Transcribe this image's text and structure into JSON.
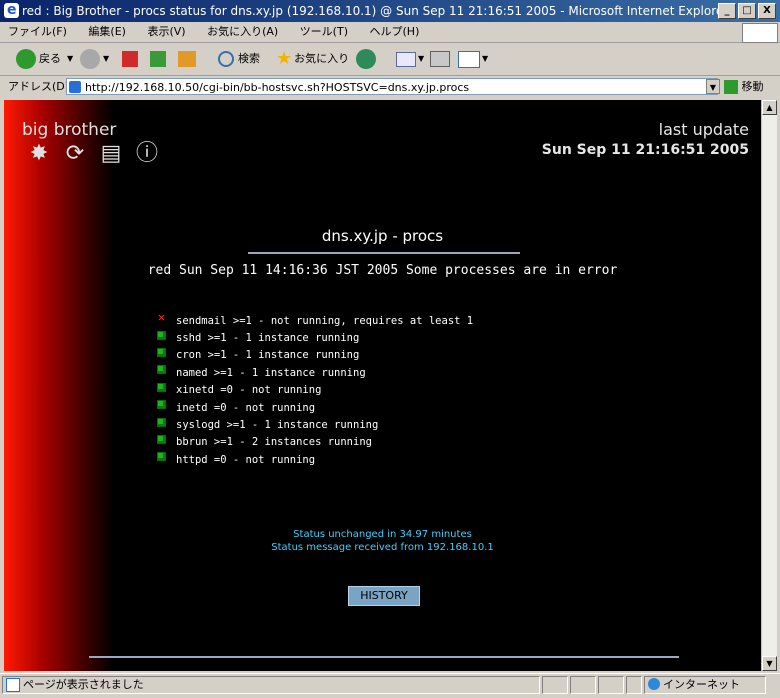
{
  "window": {
    "title": "red : Big Brother - procs status for dns.xy.jp (192.168.10.1) @ Sun Sep 11 21:16:51 2005 - Microsoft Internet Explorer",
    "min": "_",
    "max": "□",
    "close": "X"
  },
  "menu": [
    "ファイル(F)",
    "編集(E)",
    "表示(V)",
    "お気に入り(A)",
    "ツール(T)",
    "ヘルプ(H)"
  ],
  "toolbar": {
    "back": "戻る",
    "search": "検索",
    "favorites": "お気に入り"
  },
  "address": {
    "label": "アドレス(D)",
    "url": "http://192.168.10.50/cgi-bin/bb-hostsvc.sh?HOSTSVC=dns.xy.jp.procs",
    "go": "移動"
  },
  "page": {
    "brand": "big brother",
    "last_update_label": "last update",
    "last_update_date": "Sun Sep 11 21:16:51 2005",
    "host_title": "dns.xy.jp - procs",
    "status_line": "red Sun Sep 11 14:16:36 JST 2005 Some processes are in error",
    "processes": [
      {
        "status": "red",
        "text": "sendmail >=1 - not running, requires at least 1"
      },
      {
        "status": "green",
        "text": "sshd >=1 - 1 instance running"
      },
      {
        "status": "green",
        "text": "cron >=1 - 1 instance running"
      },
      {
        "status": "green",
        "text": "named >=1 - 1 instance running"
      },
      {
        "status": "green",
        "text": "xinetd =0 - not running"
      },
      {
        "status": "green",
        "text": "inetd =0 - not running"
      },
      {
        "status": "green",
        "text": "syslogd >=1 - 1 instance running"
      },
      {
        "status": "green",
        "text": "bbrun >=1 - 2 instances running"
      },
      {
        "status": "green",
        "text": "httpd =0 - not running"
      }
    ],
    "status_unchanged": "Status unchanged in 34.97 minutes",
    "status_received": "Status message received from 192.168.10.1",
    "history_button": "HISTORY"
  },
  "statusbar": {
    "message": "ページが表示されました",
    "zone": "インターネット"
  }
}
